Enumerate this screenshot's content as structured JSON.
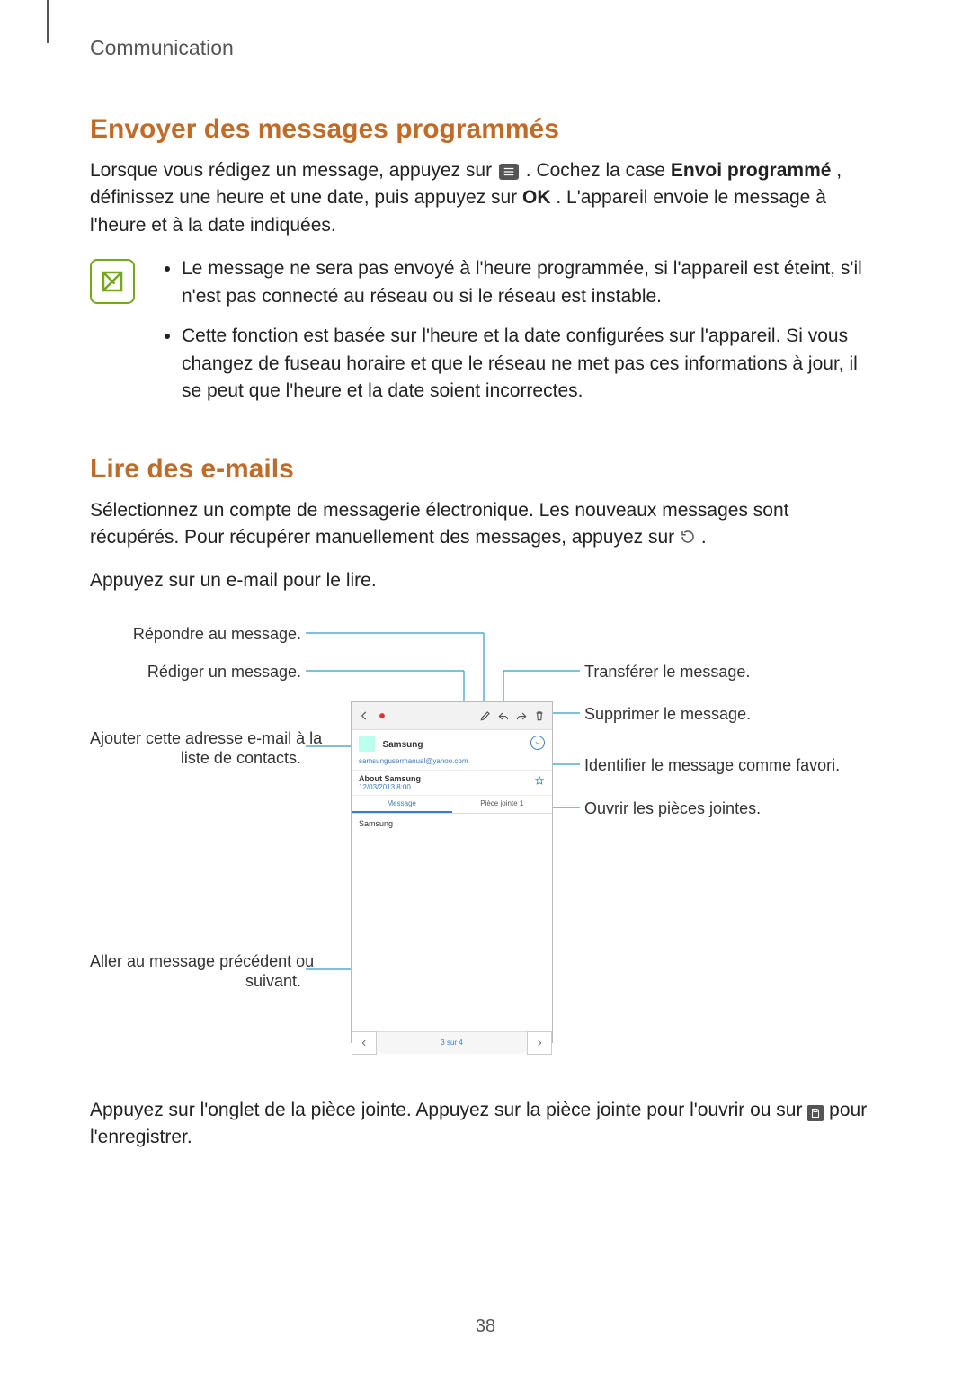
{
  "chapter": "Communication",
  "section1": {
    "heading": "Envoyer des messages programmés",
    "para_a": "Lorsque vous rédigez un message, appuyez sur ",
    "para_b": ". Cochez la case ",
    "para_bold1": "Envoi programmé",
    "para_c": ", définissez une heure et une date, puis appuyez sur ",
    "para_bold2": "OK",
    "para_d": ". L'appareil envoie le message à l'heure et à la date indiquées.",
    "note1": "Le message ne sera pas envoyé à l'heure programmée, si l'appareil est éteint, s'il n'est pas connecté au réseau ou si le réseau est instable.",
    "note2": "Cette fonction est basée sur l'heure et la date configurées sur l'appareil. Si vous changez de fuseau horaire et que le réseau ne met pas ces informations à jour, il se peut que l'heure et la date soient incorrectes."
  },
  "section2": {
    "heading": "Lire des e-mails",
    "para1_a": "Sélectionnez un compte de messagerie électronique. Les nouveaux messages sont récupérés. Pour récupérer manuellement des messages, appuyez sur ",
    "para1_b": ".",
    "para2": "Appuyez sur un e-mail pour le lire."
  },
  "callouts": {
    "reply": "Répondre au message.",
    "compose": "Rédiger un message.",
    "add_contact_l1": "Ajouter cette adresse e-mail à la",
    "add_contact_l2": "liste de contacts.",
    "prev_next_l1": "Aller au message précédent ou",
    "prev_next_l2": "suivant.",
    "forward": "Transférer le message.",
    "delete": "Supprimer le message.",
    "favorite": "Identifier le message comme favori.",
    "attachments": "Ouvrir les pièces jointes."
  },
  "phone": {
    "sender": "Samsung",
    "email": "samsungusermanual@yahoo.com",
    "subject": "About Samsung",
    "date": "12/03/2013  8:00",
    "tab_message": "Message",
    "tab_attachment": "Pièce jointe 1",
    "body": "Samsung",
    "pager": "3 sur 4"
  },
  "footer": {
    "para_a": "Appuyez sur l'onglet de la pièce jointe. Appuyez sur la pièce jointe pour l'ouvrir ou sur ",
    "para_b": " pour l'enregistrer."
  },
  "pagenum": "38"
}
